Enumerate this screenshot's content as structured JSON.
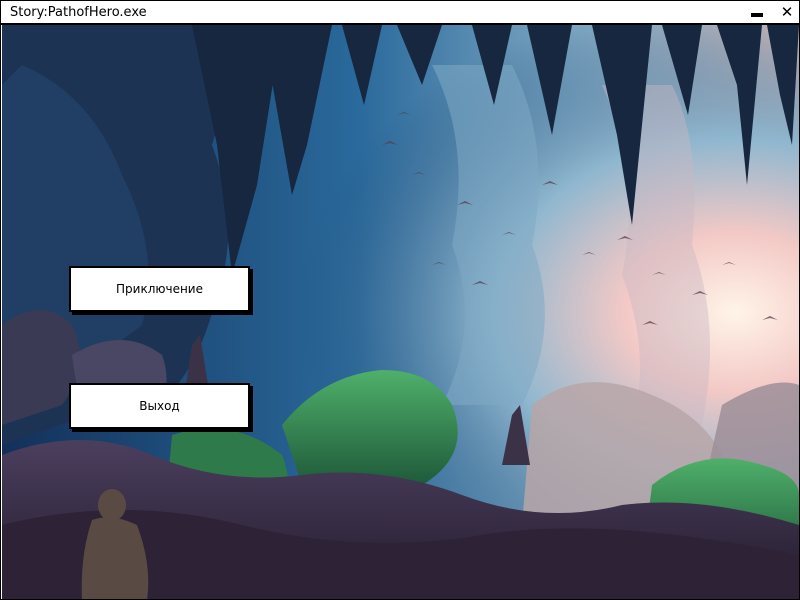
{
  "window": {
    "title": "Story:PathofHero.exe"
  },
  "menu": {
    "adventure_label": "Приключение",
    "exit_label": "Выход"
  },
  "colors": {
    "cave_dark": "#1b2a4a",
    "cave_blue": "#2f6f9e",
    "light_glow": "#f6d6c2",
    "moss_green": "#2f8a4f",
    "rock_purple": "#4a3f5a"
  },
  "icons": {
    "minimize": "minimize-icon",
    "close": "close-icon"
  }
}
